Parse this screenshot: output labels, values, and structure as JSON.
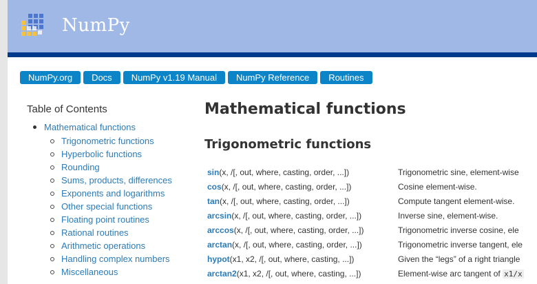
{
  "header": {
    "brand": "NumPy"
  },
  "breadcrumbs": [
    "NumPy.org",
    "Docs",
    "NumPy v1.19 Manual",
    "NumPy Reference",
    "Routines"
  ],
  "toc": {
    "title": "Table of Contents",
    "top_item": "Mathematical functions",
    "items": [
      "Trigonometric functions",
      "Hyperbolic functions",
      "Rounding",
      "Sums, products, differences",
      "Exponents and logarithms",
      "Other special functions",
      "Floating point routines",
      "Rational routines",
      "Arithmetic operations",
      "Handling complex numbers",
      "Miscellaneous"
    ]
  },
  "main": {
    "title": "Mathematical functions",
    "section": "Trigonometric functions",
    "functions": [
      {
        "name": "sin",
        "args": "(x, /[, out, where, casting, order, ...])",
        "desc": "Trigonometric sine, element-wise"
      },
      {
        "name": "cos",
        "args": "(x, /[, out, where, casting, order, ...])",
        "desc": "Cosine element-wise."
      },
      {
        "name": "tan",
        "args": "(x, /[, out, where, casting, order, ...])",
        "desc": "Compute tangent element-wise."
      },
      {
        "name": "arcsin",
        "args": "(x, /[, out, where, casting, order, ...])",
        "desc": "Inverse sine, element-wise."
      },
      {
        "name": "arccos",
        "args": "(x, /[, out, where, casting, order, ...])",
        "desc": "Trigonometric inverse cosine, ele"
      },
      {
        "name": "arctan",
        "args": "(x, /[, out, where, casting, order, ...])",
        "desc": "Trigonometric inverse tangent, ele"
      },
      {
        "name": "hypot",
        "args": "(x1, x2, /[, out, where, casting, ...])",
        "desc": "Given the “legs” of a right triangle"
      },
      {
        "name": "arctan2",
        "args": "(x1, x2, /[, out, where, casting, ...])",
        "desc": "Element-wise arc tangent of ",
        "code": "x1/x"
      }
    ]
  },
  "colors": {
    "header_bg": "#a0b8e6",
    "header_bar": "#003a8c",
    "crumb_bg": "#0c84c8",
    "link": "#2b7bb9"
  }
}
